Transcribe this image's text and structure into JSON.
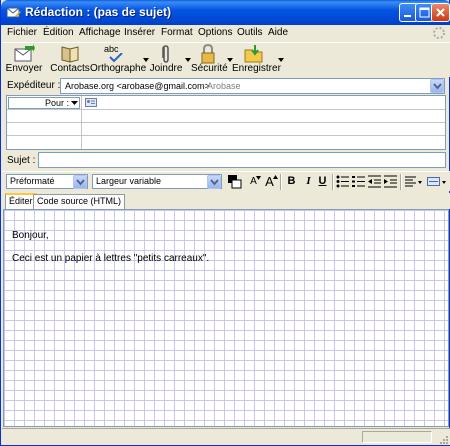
{
  "window": {
    "title": "Rédaction : (pas de sujet)"
  },
  "menu": {
    "items": [
      "Fichier",
      "Édition",
      "Affichage",
      "Insérer",
      "Format",
      "Options",
      "Outils",
      "Aide"
    ]
  },
  "toolbar": {
    "send_label": "Envoyer",
    "contacts_label": "Contacts",
    "spelling_label": "Orthographe",
    "attach_label": "Joindre",
    "security_label": "Sécurité",
    "save_label": "Enregistrer",
    "spelling_icon_text": "abc"
  },
  "sender": {
    "label": "Expéditeur :",
    "value": "Arobase.org <arobase@gmail.com>",
    "account": "- Arobase"
  },
  "recipients": {
    "type_label": "Pour :",
    "address": ""
  },
  "subject": {
    "label": "Sujet :",
    "value": ""
  },
  "format_bar": {
    "paragraph_style": "Préformaté",
    "font": "Largeur variable",
    "bold": "B",
    "italic": "I",
    "underline": "U",
    "larger_font": "A",
    "smaller_font": "A"
  },
  "editor_tabs": [
    "Éditer",
    "Code source (HTML)"
  ],
  "body": {
    "lines": [
      "Bonjour,",
      "Ceci est un papier à lettres \"petits carreaux\"."
    ]
  },
  "colors": {
    "titlebar": "#0554e3",
    "window_bg": "#ece9d8",
    "grid_lines": "#c8c8ea",
    "input_border": "#7f9db9"
  }
}
